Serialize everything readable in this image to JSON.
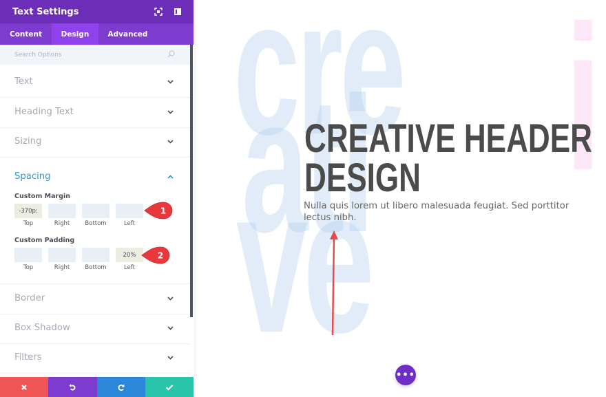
{
  "panel": {
    "title": "Text Settings",
    "header_icons": [
      "expand-icon",
      "split-view-icon"
    ],
    "tabs": [
      {
        "label": "Content",
        "active": false
      },
      {
        "label": "Design",
        "active": true
      },
      {
        "label": "Advanced",
        "active": false
      }
    ],
    "search_placeholder": "Search Options",
    "sections": [
      {
        "label": "Text",
        "expanded": false
      },
      {
        "label": "Heading Text",
        "expanded": false
      },
      {
        "label": "Sizing",
        "expanded": false
      },
      {
        "label": "Spacing",
        "expanded": true
      },
      {
        "label": "Border",
        "expanded": false
      },
      {
        "label": "Box Shadow",
        "expanded": false
      },
      {
        "label": "Filters",
        "expanded": false
      }
    ],
    "spacing": {
      "margin": {
        "label": "Custom Margin",
        "fields": [
          {
            "caption": "Top",
            "value": "-370p:"
          },
          {
            "caption": "Right",
            "value": ""
          },
          {
            "caption": "Bottom",
            "value": ""
          },
          {
            "caption": "Left",
            "value": ""
          }
        ]
      },
      "padding": {
        "label": "Custom Padding",
        "fields": [
          {
            "caption": "Top",
            "value": ""
          },
          {
            "caption": "Right",
            "value": ""
          },
          {
            "caption": "Bottom",
            "value": ""
          },
          {
            "caption": "Left",
            "value": "20%"
          }
        ]
      }
    },
    "callouts": [
      "1",
      "2"
    ],
    "footer_buttons": [
      "cancel",
      "undo",
      "redo",
      "save"
    ]
  },
  "canvas": {
    "background_words": [
      "cre",
      "ati",
      "ve",
      "i"
    ],
    "headline_lines": [
      "CREATIVE HEADER",
      "DESIGN"
    ],
    "body_text": "Nulla quis lorem ut libero malesuada feugiat. Sed porttitor lectus nibh.",
    "fab_label": "•••"
  },
  "colors": {
    "header_purple": "#6c2eb9",
    "tab_purple": "#7e3bd0",
    "active_tab": "#8f42ec",
    "spacing_blue": "#2c98d6",
    "cancel_red": "#ef5555",
    "redo_blue": "#2b87da",
    "save_green": "#29c4a9",
    "callout_red": "#e8383b"
  }
}
